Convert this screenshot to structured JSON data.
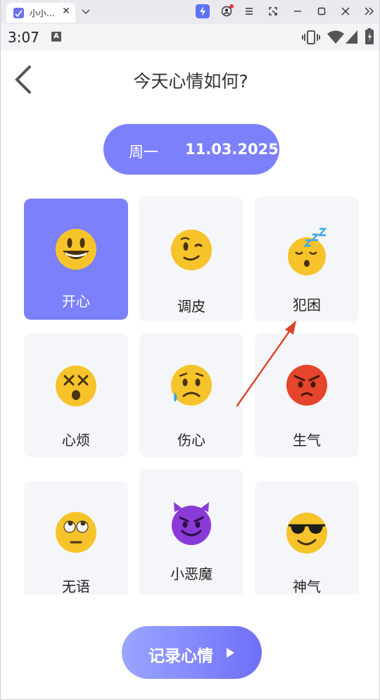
{
  "browser": {
    "tab_title": "小小...",
    "tab_close": "✕",
    "icons": [
      "favicon-icon",
      "chevron-down-icon",
      "lightning-icon",
      "profile-icon",
      "menu-icon",
      "screenshot-icon",
      "minimize-icon",
      "maximize-icon",
      "close-icon",
      "double-chevron-icon"
    ]
  },
  "status_bar": {
    "time": "3:07",
    "notification_icon": "A"
  },
  "header": {
    "title": "今天心情如何?"
  },
  "date_pill": {
    "weekday": "周一",
    "date": "11.03.2025"
  },
  "moods": [
    {
      "label": "开心",
      "emoji": "grinning-face",
      "selected": true
    },
    {
      "label": "调皮",
      "emoji": "winking-face",
      "selected": false
    },
    {
      "label": "犯困",
      "emoji": "sleeping-face",
      "selected": false
    },
    {
      "label": "心烦",
      "emoji": "dizzy-face",
      "selected": false
    },
    {
      "label": "伤心",
      "emoji": "sad-sweat-face",
      "selected": false
    },
    {
      "label": "生气",
      "emoji": "angry-face",
      "selected": false
    },
    {
      "label": "无语",
      "emoji": "eye-roll-face",
      "selected": false
    },
    {
      "label": "小恶魔",
      "emoji": "smiling-devil",
      "selected": false
    },
    {
      "label": "神气",
      "emoji": "sunglasses-face",
      "selected": false
    }
  ],
  "record_button": {
    "label": "记录心情"
  },
  "colors": {
    "accent": "#7c80fb",
    "card": "#f5f6f9",
    "emoji_yellow": "#f6c42a",
    "angry_red": "#e5452a",
    "devil_purple": "#8a3ad6",
    "annotation_arrow": "#d8452a"
  }
}
